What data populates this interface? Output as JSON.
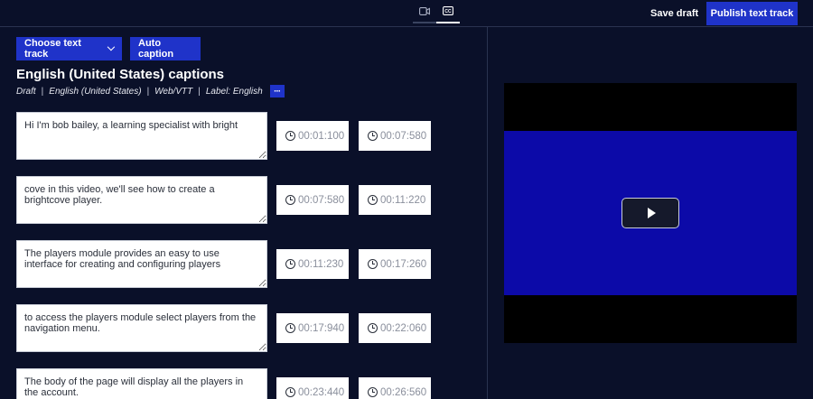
{
  "toolbar": {
    "video_tab_icon": "video-camera-icon",
    "cc_tab_icon": "closed-captions-icon",
    "save_draft_label": "Save draft",
    "publish_label": "Publish text track"
  },
  "actions": {
    "choose_track_label": "Choose text track",
    "auto_caption_label": "Auto caption"
  },
  "track": {
    "title": "English (United States) captions",
    "status": "Draft",
    "language": "English (United States)",
    "format": "Web/VTT",
    "label": "Label: English",
    "more_label": "···"
  },
  "cues": [
    {
      "text": "Hi I'm bob bailey, a learning specialist with bright",
      "start": "00:01:100",
      "end": "00:07:580"
    },
    {
      "text": "cove in this video, we'll see how to create a brightcove player.",
      "start": "00:07:580",
      "end": "00:11:220"
    },
    {
      "text": "The players module provides an easy to use interface for creating and configuring players",
      "start": "00:11:230",
      "end": "00:17:260"
    },
    {
      "text": "to access the players module select players from the navigation menu.",
      "start": "00:17:940",
      "end": "00:22:060"
    },
    {
      "text": "The body of the page will display all the players in the account.",
      "start": "00:23:440",
      "end": "00:26:560"
    }
  ],
  "player": {
    "play_icon": "play-icon"
  },
  "colors": {
    "background": "#0a1029",
    "accent": "#1f33c9",
    "video_frame": "#0c0aa8"
  }
}
